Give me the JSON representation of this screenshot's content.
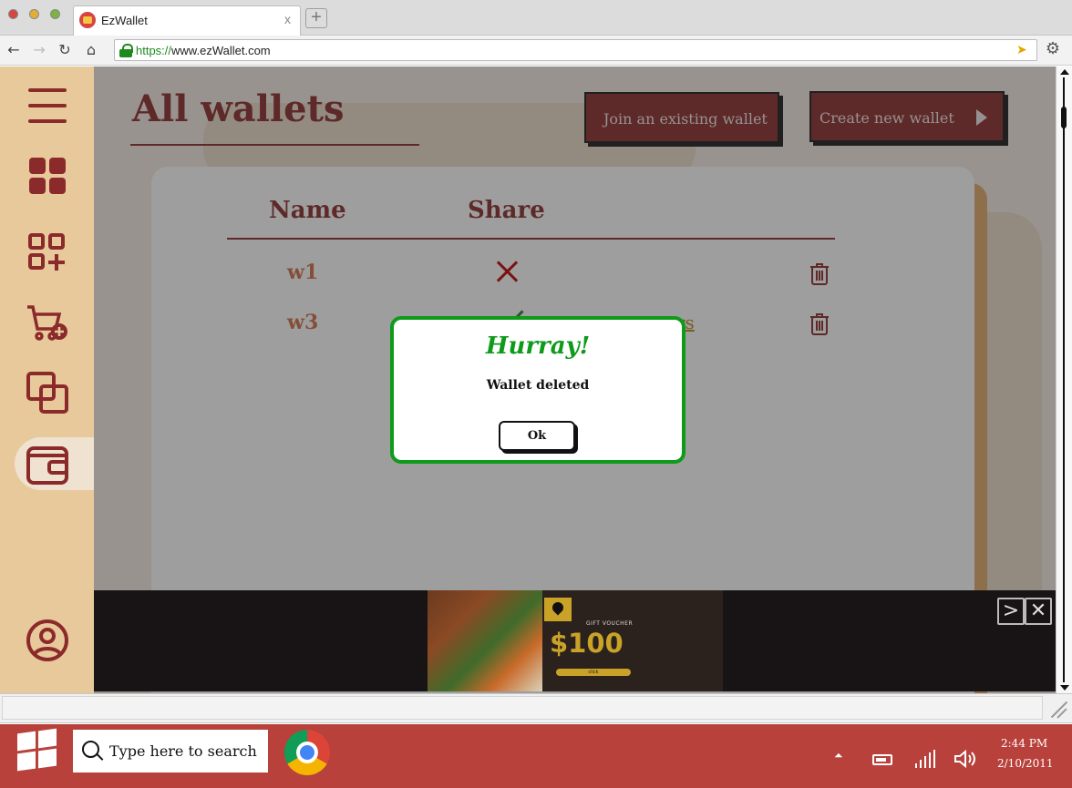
{
  "browser": {
    "tab_title": "EzWallet",
    "tab_close": "x",
    "new_tab": "+",
    "url_scheme": "https://",
    "url_rest": "www.ezWallet.com"
  },
  "sidebar": {
    "items": [
      {
        "icon": "menu-icon"
      },
      {
        "icon": "dashboard-grid-icon"
      },
      {
        "icon": "add-category-icon"
      },
      {
        "icon": "cart-add-icon"
      },
      {
        "icon": "overlap-squares-icon"
      },
      {
        "icon": "wallet-icon",
        "active": true
      },
      {
        "icon": "user-profile-icon"
      }
    ],
    "colors": {
      "background": "#e8c99b",
      "icon": "#8b2a2a"
    }
  },
  "page": {
    "title": "All wallets",
    "join_button": "Join an existing wallet",
    "create_button": "Create new wallet"
  },
  "table": {
    "headers": {
      "name": "Name",
      "share": "Share"
    },
    "rows": [
      {
        "name": "w1",
        "share": "not-shared",
        "users": ""
      },
      {
        "name": "w3",
        "share": "shared",
        "users": "users"
      }
    ]
  },
  "dialog": {
    "title": "Hurray!",
    "message": "Wallet deleted",
    "ok_label": "Ok",
    "accent": "#0e9a1a"
  },
  "ad": {
    "voucher_label": "GIFT VOUCHER",
    "amount": "$100",
    "cta": "click",
    "next_symbol": ">",
    "close_symbol": "✕"
  },
  "taskbar": {
    "search_placeholder": "Type here to search",
    "tray_up_symbol": "⏶",
    "time": "2:44 PM",
    "date": "2/10/2011"
  },
  "colors": {
    "brand": "#8b2a2a",
    "taskbar": "#b8413b",
    "success": "#0e9a1a",
    "delete": "#c00000"
  }
}
